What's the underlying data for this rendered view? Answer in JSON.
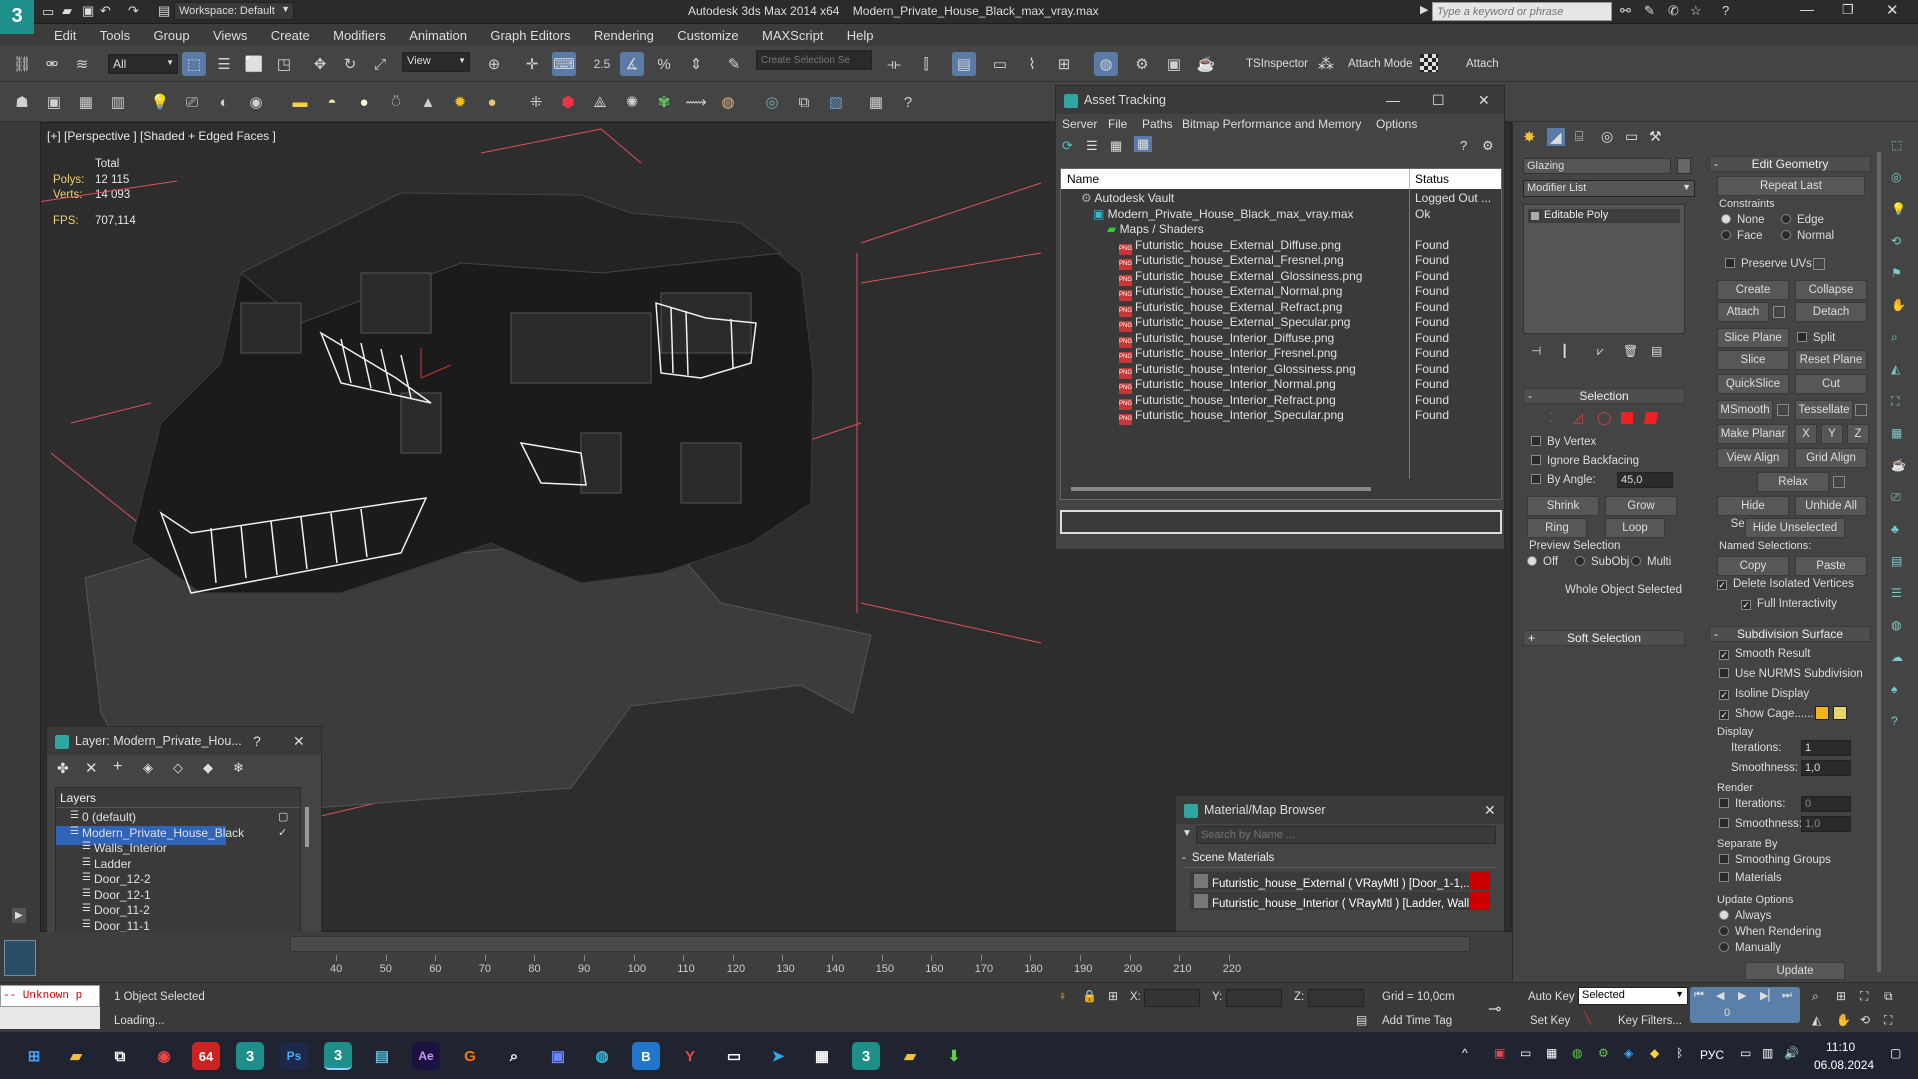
{
  "app": {
    "title": "Autodesk 3ds Max  2014 x64",
    "filename": "Modern_Private_House_Black_max_vray.max",
    "workspace": "Workspace: Default",
    "search_placeholder": "Type a keyword or phrase"
  },
  "menu": [
    "Edit",
    "Tools",
    "Group",
    "Views",
    "Create",
    "Modifiers",
    "Animation",
    "Graph Editors",
    "Rendering",
    "Customize",
    "MAXScript",
    "Help"
  ],
  "toolbar": {
    "filter_select": "All",
    "ref_coord": "View",
    "snap_value": "2.5",
    "named_sel_placeholder": "Create Selection Se",
    "tsinspector": "TSInspector",
    "attach_mode": "Attach Mode",
    "attach": "Attach"
  },
  "viewport": {
    "label": "[+] [Perspective ] [Shaded + Edged Faces ]",
    "total_label": "Total",
    "polys_label": "Polys:",
    "polys": "12 115",
    "verts_label": "Verts:",
    "verts": "14 093",
    "fps_label": "FPS:",
    "fps": "707,114"
  },
  "asset_tracking": {
    "title": "Asset Tracking",
    "menu": [
      "Server",
      "File",
      "Paths",
      "Bitmap Performance and Memory",
      "Options"
    ],
    "col_name": "Name",
    "col_status": "Status",
    "rows": [
      {
        "name": "Autodesk Vault",
        "status": "Logged Out ...",
        "indent": 20,
        "type": "vault"
      },
      {
        "name": "Modern_Private_House_Black_max_vray.max",
        "status": "Ok",
        "indent": 32,
        "type": "max"
      },
      {
        "name": "Maps / Shaders",
        "status": "",
        "indent": 46,
        "type": "folder"
      },
      {
        "name": "Futuristic_house_External_Diffuse.png",
        "status": "Found",
        "indent": 58,
        "type": "png"
      },
      {
        "name": "Futuristic_house_External_Fresnel.png",
        "status": "Found",
        "indent": 58,
        "type": "png"
      },
      {
        "name": "Futuristic_house_External_Glossiness.png",
        "status": "Found",
        "indent": 58,
        "type": "png"
      },
      {
        "name": "Futuristic_house_External_Normal.png",
        "status": "Found",
        "indent": 58,
        "type": "png"
      },
      {
        "name": "Futuristic_house_External_Refract.png",
        "status": "Found",
        "indent": 58,
        "type": "png"
      },
      {
        "name": "Futuristic_house_External_Specular.png",
        "status": "Found",
        "indent": 58,
        "type": "png"
      },
      {
        "name": "Futuristic_house_Interior_Diffuse.png",
        "status": "Found",
        "indent": 58,
        "type": "png"
      },
      {
        "name": "Futuristic_house_Interior_Fresnel.png",
        "status": "Found",
        "indent": 58,
        "type": "png"
      },
      {
        "name": "Futuristic_house_Interior_Glossiness.png",
        "status": "Found",
        "indent": 58,
        "type": "png"
      },
      {
        "name": "Futuristic_house_Interior_Normal.png",
        "status": "Found",
        "indent": 58,
        "type": "png"
      },
      {
        "name": "Futuristic_house_Interior_Refract.png",
        "status": "Found",
        "indent": 58,
        "type": "png"
      },
      {
        "name": "Futuristic_house_Interior_Specular.png",
        "status": "Found",
        "indent": 58,
        "type": "png"
      }
    ]
  },
  "layer_panel": {
    "title": "Layer: Modern_Private_Hou...",
    "help": "?",
    "header": "Layers",
    "items": [
      {
        "name": "0 (default)",
        "indent": 14,
        "selected": false
      },
      {
        "name": "Modern_Private_House_Black",
        "indent": 14,
        "selected": true
      },
      {
        "name": "Walls_Interior",
        "indent": 26,
        "selected": false
      },
      {
        "name": "Ladder",
        "indent": 26,
        "selected": false
      },
      {
        "name": "Door_12-2",
        "indent": 26,
        "selected": false
      },
      {
        "name": "Door_12-1",
        "indent": 26,
        "selected": false
      },
      {
        "name": "Door_11-2",
        "indent": 26,
        "selected": false
      },
      {
        "name": "Door_11-1",
        "indent": 26,
        "selected": false
      }
    ]
  },
  "material_browser": {
    "title": "Material/Map Browser",
    "search_placeholder": "Search by Name ...",
    "section": "Scene Materials",
    "items": [
      "Futuristic_house_External  ( VRayMtl )  [Door_1-1,...",
      "Futuristic_house_Interior  ( VRayMtl )  [Ladder, Wall..."
    ]
  },
  "command_panel": {
    "object_name": "Glazing",
    "modifier_list": "Modifier List",
    "stack_item": "Editable Poly",
    "selection": {
      "title": "Selection",
      "by_vertex": "By Vertex",
      "ignore_backfacing": "Ignore Backfacing",
      "by_angle": "By Angle:",
      "angle_value": "45,0",
      "shrink": "Shrink",
      "grow": "Grow",
      "ring": "Ring",
      "loop": "Loop",
      "preview": "Preview Selection",
      "off": "Off",
      "subobj": "SubObj",
      "multi": "Multi",
      "status": "Whole Object Selected"
    },
    "soft_selection": "Soft Selection",
    "edit_geometry": {
      "title": "Edit Geometry",
      "repeat_last": "Repeat Last",
      "constraints": "Constraints",
      "none": "None",
      "edge": "Edge",
      "face": "Face",
      "normal": "Normal",
      "preserve_uvs": "Preserve UVs",
      "create": "Create",
      "collapse": "Collapse",
      "attach": "Attach",
      "detach": "Detach",
      "slice_plane": "Slice Plane",
      "split": "Split",
      "slice": "Slice",
      "reset_plane": "Reset Plane",
      "quickslice": "QuickSlice",
      "cut": "Cut",
      "msmooth": "MSmooth",
      "tessellate": "Tessellate",
      "make_planar": "Make Planar",
      "x": "X",
      "y": "Y",
      "z": "Z",
      "view_align": "View Align",
      "grid_align": "Grid Align",
      "relax": "Relax",
      "hide_selected": "Hide Selected",
      "unhide_all": "Unhide All",
      "hide_unselected": "Hide Unselected",
      "named_selections": "Named Selections:",
      "copy": "Copy",
      "paste": "Paste",
      "delete_isolated": "Delete Isolated Vertices",
      "full_interactivity": "Full Interactivity"
    },
    "subdivision": {
      "title": "Subdivision Surface",
      "smooth_result": "Smooth Result",
      "use_nurms": "Use NURMS Subdivision",
      "isoline": "Isoline Display",
      "show_cage": "Show Cage......",
      "display": "Display",
      "iterations_label": "Iterations:",
      "iterations": "1",
      "smoothness_label": "Smoothness:",
      "smoothness": "1,0",
      "render": "Render",
      "r_iterations": "0",
      "r_smoothness": "1,0",
      "separate_by": "Separate By",
      "smoothing_groups": "Smoothing Groups",
      "materials": "Materials",
      "update_options": "Update Options",
      "always": "Always",
      "when_rendering": "When Rendering",
      "manually": "Manually",
      "update": "Update"
    },
    "cage_colors": [
      "#f2b01a",
      "#e8d46a"
    ]
  },
  "timeline": {
    "ticks": [
      "40",
      "50",
      "60",
      "70",
      "80",
      "90",
      "100",
      "110",
      "120",
      "130",
      "140",
      "150",
      "160",
      "170",
      "180",
      "190",
      "200",
      "210",
      "220"
    ]
  },
  "status": {
    "selected": "1 Object Selected",
    "loading": "Loading...",
    "script_listener": "-- Unknown p",
    "x_label": "X:",
    "y_label": "Y:",
    "z_label": "Z:",
    "grid": "Grid = 10,0cm",
    "add_time_tag": "Add Time Tag",
    "auto_key": "Auto Key",
    "set_key": "Set Key",
    "key_mode": "Selected",
    "key_filters": "Key Filters...",
    "frame_value": "0"
  },
  "taskbar": {
    "lang": "РУС",
    "time": "11:10",
    "date": "06.08.2024"
  }
}
